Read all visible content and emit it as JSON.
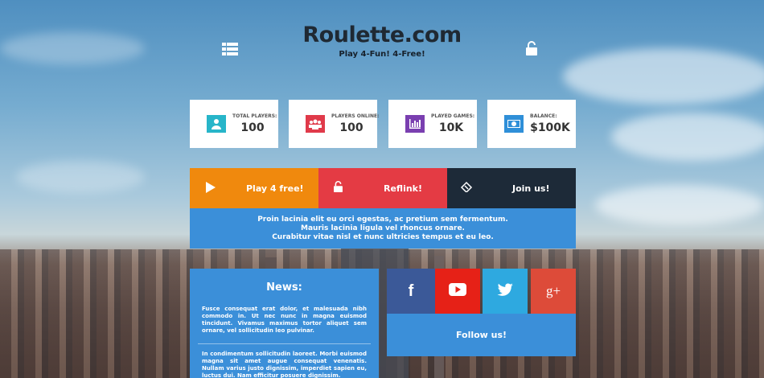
{
  "header": {
    "title": "Roulette.com",
    "subtitle": "Play 4-Fun! 4-Free!",
    "menu_icon": "list-menu-icon",
    "lock_icon": "unlock-icon"
  },
  "stats": [
    {
      "label": "TOTAL PLAYERS:",
      "value": "100",
      "icon": "user-icon",
      "color": "#27b5c9"
    },
    {
      "label": "PLAYERS ONLINE:",
      "value": "100",
      "icon": "group-icon",
      "color": "#e03a4a"
    },
    {
      "label": "PLAYED GAMES:",
      "value": "10K",
      "icon": "bar-chart-icon",
      "color": "#7a3fb0"
    },
    {
      "label": "BALANCE:",
      "value": "$100K",
      "icon": "money-icon",
      "color": "#2f8fd8"
    }
  ],
  "actions": [
    {
      "label": "Play 4 free!",
      "icon": "play-icon",
      "color": "#f0890d"
    },
    {
      "label": "Reflink!",
      "icon": "unlock-icon",
      "color": "#e43b44"
    },
    {
      "label": "Join us!",
      "icon": "ticket-icon",
      "color": "#1d2a38"
    }
  ],
  "info": {
    "line1": "Proin lacinia elit eu orci egestas, ac pretium sem fermentum.",
    "line2": "Mauris lacinia ligula vel rhoncus ornare.",
    "line3": "Curabitur vitae nisl et nunc ultricies tempus et eu leo."
  },
  "news": {
    "title": "News:",
    "para1": "Fusce consequat erat dolor, et malesuada nibh commodo in. Ut nec nunc in magna euismod tincidunt. Vivamus maximus tortor aliquet sem ornare, vel sollicitudin leo pulvinar.",
    "para2": "In condimentum sollicitudin laoreet. Morbi euismod magna sit amet augue consequat venenatis. Nullam varius justo dignissim, imperdiet sapien eu, luctus dui. Nam efficitur posuere dignissim."
  },
  "social": [
    {
      "name": "facebook",
      "glyph": "f",
      "color": "#3b5998"
    },
    {
      "name": "youtube",
      "glyph": "",
      "color": "#e62117"
    },
    {
      "name": "twitter",
      "glyph": "",
      "color": "#2ea9e0"
    },
    {
      "name": "google-plus",
      "glyph": "g+",
      "color": "#dd4b39"
    }
  ],
  "follow_label": "Follow us!"
}
